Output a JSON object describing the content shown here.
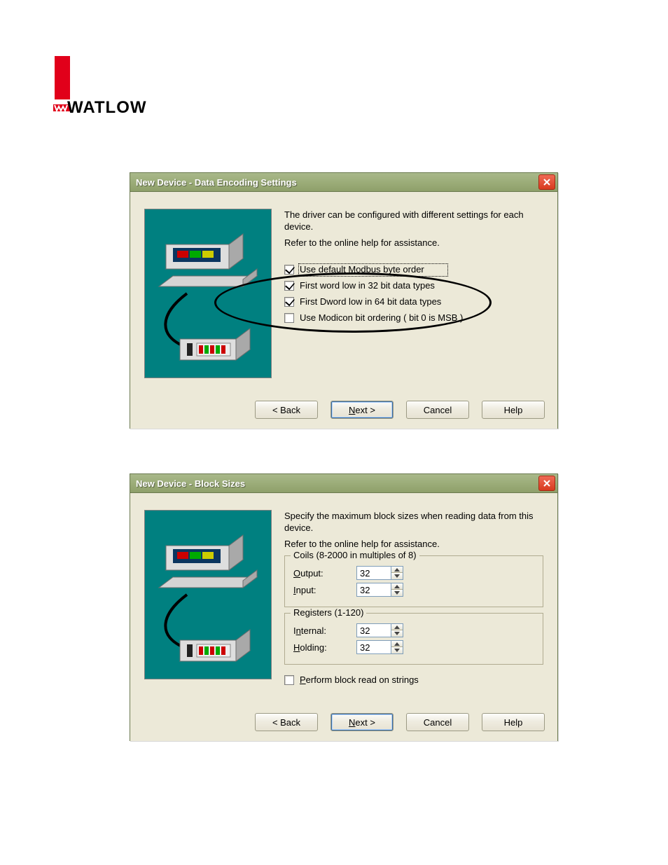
{
  "brand": {
    "name": "WATLOW"
  },
  "dialog1": {
    "title": "New Device - Data Encoding Settings",
    "desc1": "The driver can be configured with different settings for each device.",
    "desc2": "Refer to the online help for assistance.",
    "checks": [
      {
        "label": "Use default Modbus byte order",
        "checked": true,
        "focused": true
      },
      {
        "label": "First word low in 32 bit data types",
        "checked": true,
        "focused": false
      },
      {
        "label": "First Dword low in 64 bit data types",
        "checked": true,
        "focused": false
      },
      {
        "label": "Use Modicon bit ordering ( bit 0 is MSB )",
        "checked": false,
        "focused": false
      }
    ],
    "buttons": {
      "back": "< Back",
      "next": "Next >",
      "cancel": "Cancel",
      "help": "Help"
    }
  },
  "dialog2": {
    "title": "New Device - Block Sizes",
    "desc1": "Specify the maximum block sizes when reading data from this device.",
    "desc2": "Refer to the online help for assistance.",
    "coils": {
      "legend": "Coils (8-2000 in multiples of 8)",
      "output_label": "Output:",
      "output_value": "32",
      "input_label": "Input:",
      "input_value": "32"
    },
    "registers": {
      "legend": "Registers (1-120)",
      "internal_label": "Internal:",
      "internal_value": "32",
      "holding_label": "Holding:",
      "holding_value": "32"
    },
    "perform_label": "Perform block read on strings",
    "perform_checked": false,
    "buttons": {
      "back": "< Back",
      "next": "Next >",
      "cancel": "Cancel",
      "help": "Help"
    }
  }
}
